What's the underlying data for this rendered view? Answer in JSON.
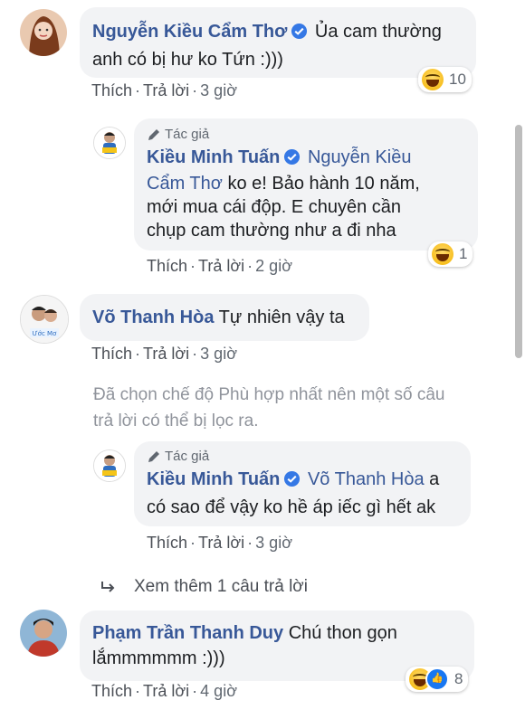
{
  "comments": [
    {
      "name": "Nguyễn Kiều Cẩm Thơ",
      "text_line1": "Ủa cam thường",
      "text_line2": "anh có bị hư ko Tứn :)))",
      "react_count": "10",
      "like": "Thích",
      "reply": "Trả lời",
      "time": "3 giờ"
    },
    {
      "author_label": "Tác giả",
      "name": "Kiều Minh Tuấn",
      "tag": "Nguyễn Kiều",
      "line2_tag": "Cẩm Thơ",
      "line2_text": " ko e! Bảo hành 10 năm,",
      "line3": "mới mua cái độp. E chuyên cần",
      "line4": "chụp cam thường như a đi nha",
      "react_count": "1",
      "like": "Thích",
      "reply": "Trả lời",
      "time": "2 giờ"
    },
    {
      "name": "Võ Thanh Hòa",
      "text": "Tự nhiên vậy ta",
      "like": "Thích",
      "reply": "Trả lời",
      "time": "3 giờ"
    },
    {
      "author_label": "Tác giả",
      "name": "Kiều Minh Tuấn",
      "tag": "Võ Thanh Hòa",
      "text_after": "a",
      "line2": "có sao để vậy ko hề áp iếc gì hết ak",
      "like": "Thích",
      "reply": "Trả lời",
      "time": "3 giờ"
    },
    {
      "name": "Phạm Trần Thanh Duy",
      "text_line1": "Chú thon gọn",
      "text_line2": "lắmmmmmm :)))",
      "react_count": "8",
      "like": "Thích",
      "reply": "Trả lời",
      "time": "4 giờ"
    }
  ],
  "filter_notice_line1": "Đã chọn chế độ Phù hợp nhất nên một số câu",
  "filter_notice_line2": "trả lời có thể bị lọc ra.",
  "more_replies": "Xem thêm 1 câu trả lời",
  "separator": "·",
  "colors": {
    "link": "#385898",
    "bubble": "#f2f3f5",
    "meta": "#606770",
    "verified": "#3578e5"
  }
}
